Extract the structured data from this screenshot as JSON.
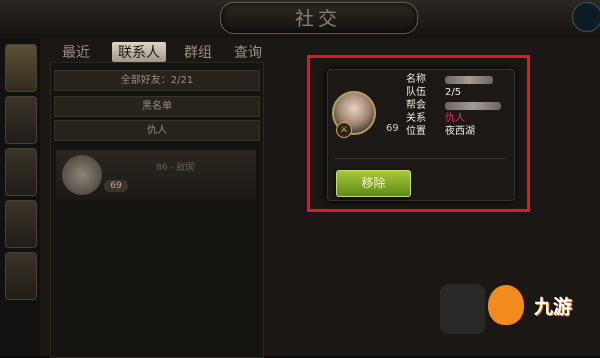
{
  "window": {
    "title": "社交"
  },
  "top_tabs": [
    {
      "label": "最近",
      "active": false
    },
    {
      "label": "联系人",
      "active": true
    },
    {
      "label": "群组",
      "active": false
    },
    {
      "label": "查询",
      "active": false
    }
  ],
  "list": {
    "rows": [
      {
        "label": "全部好友：2/21"
      },
      {
        "label": "黑名单"
      },
      {
        "label": "仇人"
      }
    ],
    "friend": {
      "level": "69",
      "meta": "86 - 敌国"
    }
  },
  "popup": {
    "level": "69",
    "fields": [
      {
        "label": "名称",
        "value": ""
      },
      {
        "label": "队伍",
        "value": "2/5"
      },
      {
        "label": "帮会",
        "value": ""
      },
      {
        "label": "关系",
        "value": "仇人"
      },
      {
        "label": "位置",
        "value": "夜西湖"
      }
    ],
    "remove_label": "移除",
    "relation_color": "#e8305a",
    "button_color": "#8fb82a"
  },
  "watermark": {
    "text": "九游"
  },
  "colors": {
    "highlight": "#e01820"
  }
}
